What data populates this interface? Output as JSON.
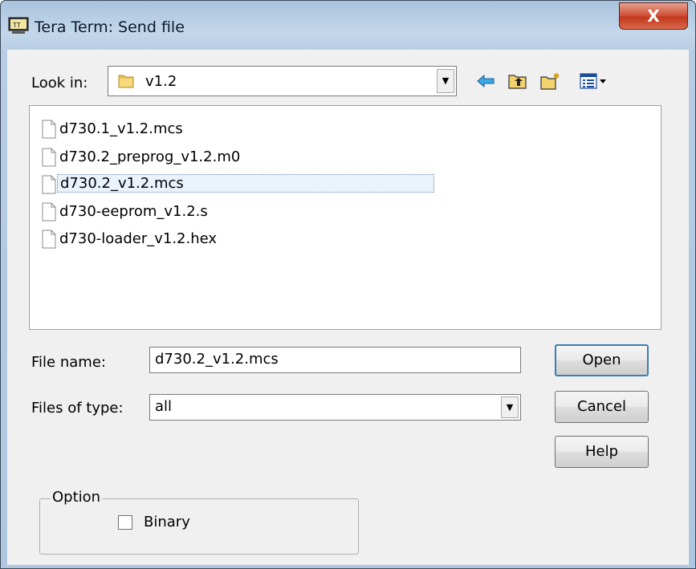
{
  "window": {
    "title": "Tera Term: Send file",
    "close_label": "X"
  },
  "lookin": {
    "label": "Look in:",
    "value": "v1.2"
  },
  "toolbar": {
    "icons": [
      "back-icon",
      "up-folder-icon",
      "new-folder-icon",
      "view-menu-icon"
    ]
  },
  "files": {
    "items": [
      {
        "name": "d730.1_v1.2.mcs"
      },
      {
        "name": "d730.2_preprog_v1.2.m0"
      },
      {
        "name": "d730.2_v1.2.mcs"
      },
      {
        "name": "d730-eeprom_v1.2.s"
      },
      {
        "name": "d730-loader_v1.2.hex"
      }
    ],
    "selected_index": 2
  },
  "filename": {
    "label": "File name:",
    "value": "d730.2_v1.2.mcs"
  },
  "filetype": {
    "label": "Files of type:",
    "value": "all"
  },
  "buttons": {
    "open": "Open",
    "cancel": "Cancel",
    "help": "Help"
  },
  "option": {
    "legend": "Option",
    "binary_label": "Binary",
    "binary_checked": false
  },
  "colors": {
    "accent": "#3c7fb1",
    "title_bar": "#b6cde4",
    "close_button": "#c2381f"
  }
}
